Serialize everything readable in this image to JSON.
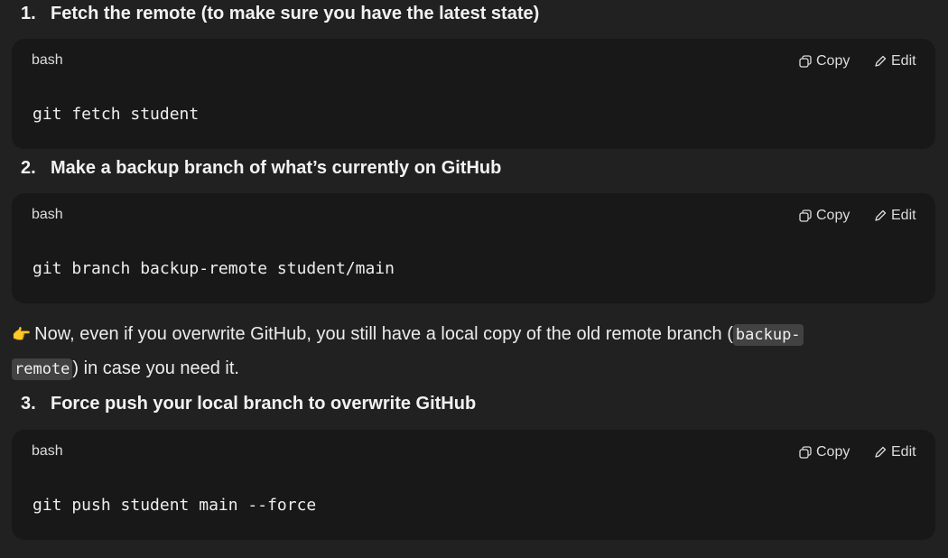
{
  "steps": [
    {
      "number": "1.",
      "title": "Fetch the remote (to make sure you have the latest state)",
      "code": {
        "language": "bash",
        "copy_label": "Copy",
        "edit_label": "Edit",
        "command": "git fetch student"
      }
    },
    {
      "number": "2.",
      "title": "Make a backup branch of what’s currently on GitHub",
      "code": {
        "language": "bash",
        "copy_label": "Copy",
        "edit_label": "Edit",
        "command": "git branch backup-remote student/main"
      }
    },
    {
      "number": "3.",
      "title": "Force push your local branch to overwrite GitHub",
      "code": {
        "language": "bash",
        "copy_label": "Copy",
        "edit_label": "Edit",
        "command": "git push student main --force"
      }
    }
  ],
  "note": {
    "emoji": "👉",
    "text_before": "Now, even if you overwrite GitHub, you still have a local copy of the old remote branch (",
    "inline_code_part1": "backup-",
    "inline_code_part2": "remote",
    "text_after": ") in case you need it."
  },
  "icons": {
    "copy": "copy-icon",
    "edit": "pencil-icon"
  },
  "colors": {
    "background": "#212121",
    "code_block": "#181818",
    "inline_code_bg": "#424242",
    "text": "#ececec"
  }
}
